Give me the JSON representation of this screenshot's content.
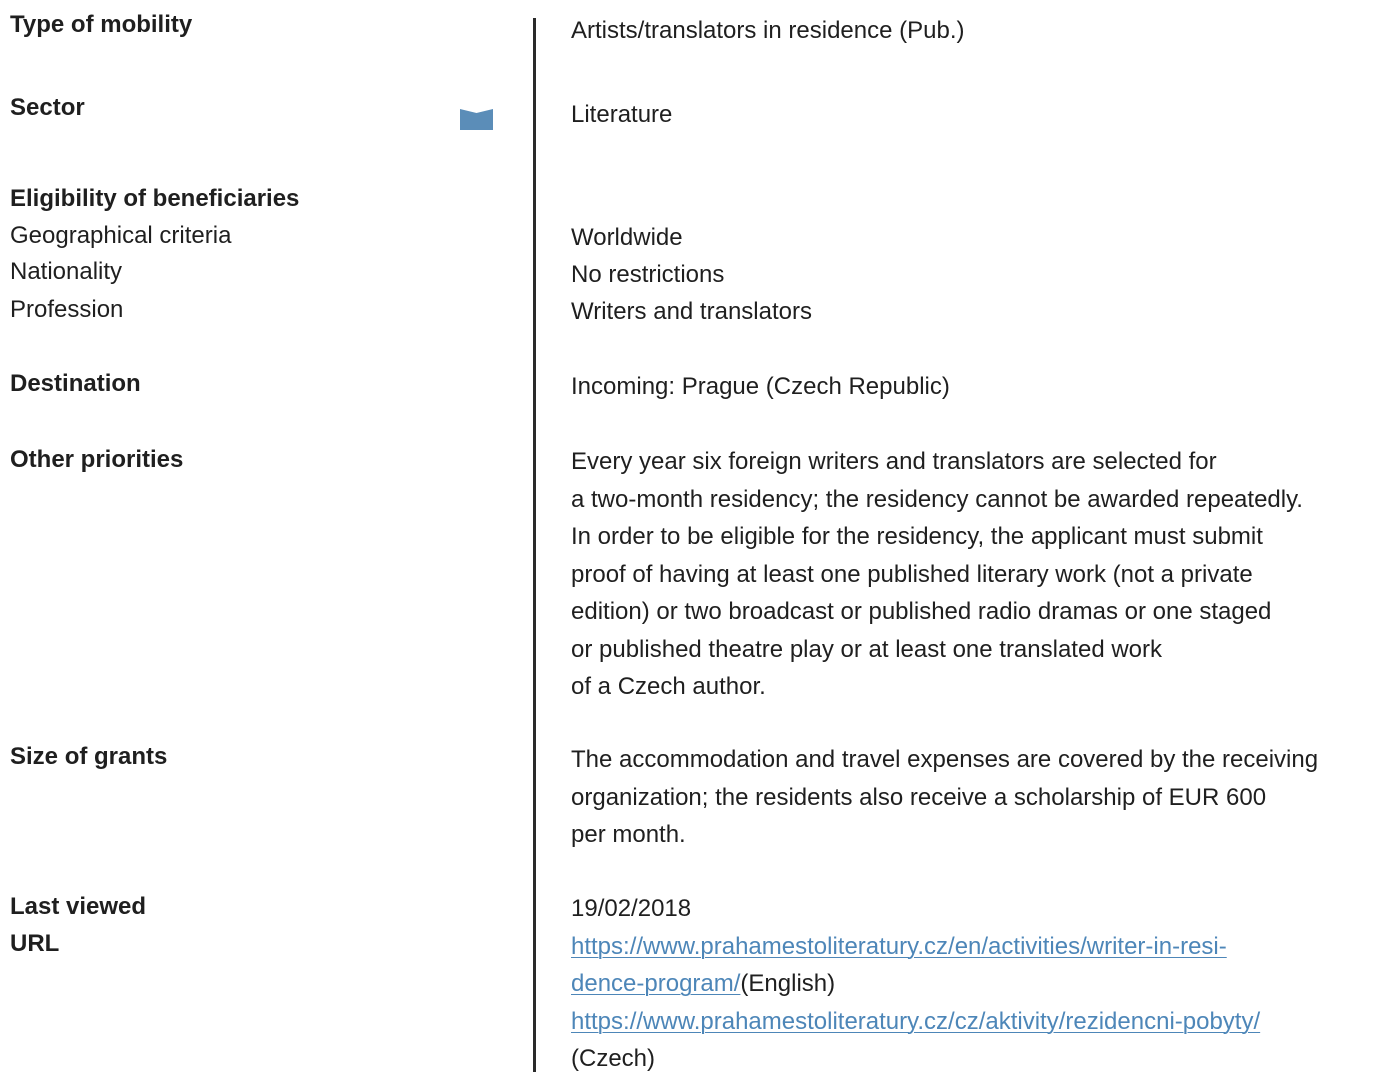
{
  "labels": {
    "type_of_mobility": "Type of mobility",
    "sector": "Sector",
    "eligibility": "Eligibility of beneficiaries",
    "geographical_criteria": "Geographical criteria",
    "nationality": "Nationality",
    "profession": "Profession",
    "destination": "Destination",
    "other_priorities": "Other priorities",
    "size_of_grants": "Size of grants",
    "last_viewed": "Last viewed",
    "url": "URL"
  },
  "values": {
    "type_of_mobility": "Artists/translators in residence (Pub.)",
    "sector": "Literature",
    "geographical_criteria": "Worldwide",
    "nationality": "No restrictions",
    "profession": "Writers and translators",
    "destination": "Incoming: Prague (Czech Republic)",
    "other_priorities": [
      "Every year six foreign writers and translators are selected for",
      "a two-month residency; the residency cannot be awarded repeatedly.",
      "In order to be eligible for the residency, the applicant must submit",
      "proof of having at least one published literary work (not a private",
      "edition) or two broadcast or published radio dramas or one staged",
      "or published theatre play or at least one translated work",
      "of a Czech author."
    ],
    "size_of_grants": [
      "The accommodation and travel expenses are covered by the receiving",
      "organization; the residents also receive a scholarship of EUR 600",
      "per month."
    ],
    "last_viewed": "19/02/2018",
    "url_english_line1": "https://www.prahamestoliteratury.cz/en/activities/writer-in-resi-",
    "url_english_line2": "dence-program/",
    "url_english_lang": "(English)",
    "url_czech": "https://www.prahamestoliteratury.cz/cz/aktivity/rezidencni-pobyty/",
    "url_czech_lang": "(Czech)"
  },
  "icons": {
    "sector_marker": "bookmark-icon"
  },
  "colors": {
    "text": "#1f1f1f",
    "link": "#4d86b8",
    "bookmark": "#5b8db8",
    "divider": "#2a2a2a"
  }
}
